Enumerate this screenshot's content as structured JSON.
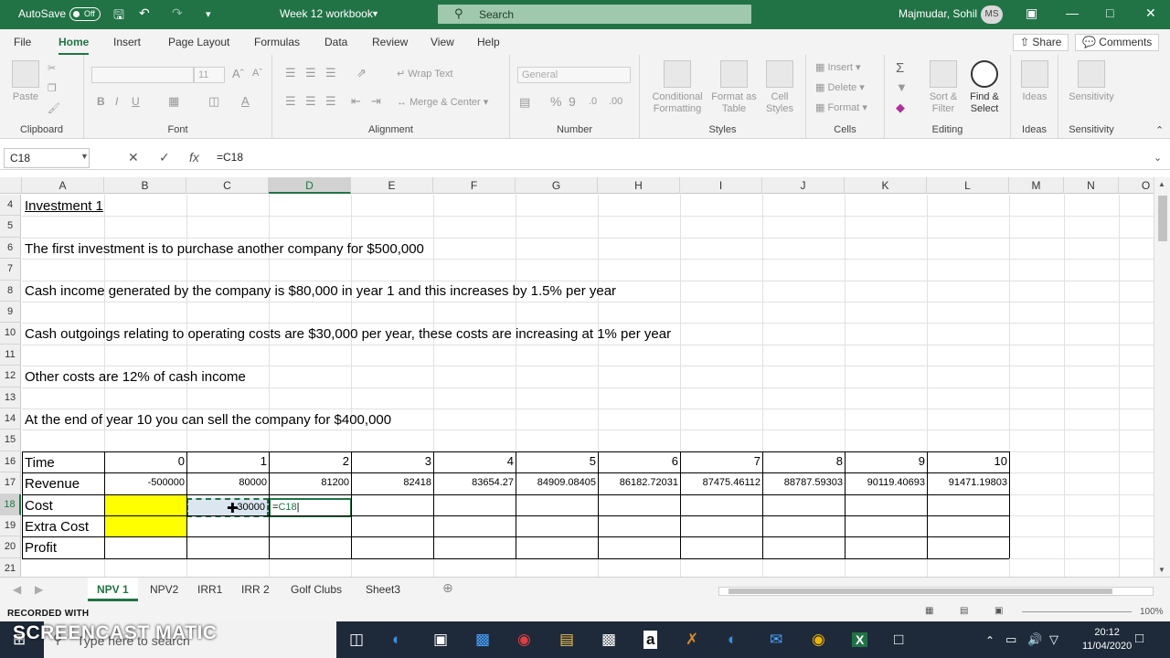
{
  "titlebar": {
    "autosave": "AutoSave",
    "toggle": "Off",
    "doc_title": "Week 12 workbook",
    "search": "Search",
    "user": "Majmudar, Sohil",
    "initials": "MS"
  },
  "ribbon_tabs": [
    "File",
    "Home",
    "Insert",
    "Page Layout",
    "Formulas",
    "Data",
    "Review",
    "View",
    "Help"
  ],
  "share": "Share",
  "comments": "Comments",
  "ribbon": {
    "clipboard": {
      "label": "Clipboard",
      "paste": "Paste"
    },
    "font": {
      "label": "Font",
      "size": "11"
    },
    "alignment": {
      "label": "Alignment",
      "wrap": "Wrap Text",
      "merge": "Merge & Center"
    },
    "number": {
      "label": "Number",
      "format": "General"
    },
    "styles": {
      "label": "Styles",
      "cond1": "Conditional",
      "cond2": "Formatting",
      "fmt1": "Format as",
      "fmt2": "Table",
      "cell1": "Cell",
      "cell2": "Styles"
    },
    "cells": {
      "label": "Cells",
      "insert": "Insert",
      "delete": "Delete",
      "format": "Format"
    },
    "editing": {
      "label": "Editing",
      "sort1": "Sort &",
      "sort2": "Filter",
      "find1": "Find &",
      "find2": "Select"
    },
    "ideas": {
      "label": "Ideas",
      "btn": "Ideas"
    },
    "sensitivity": {
      "label": "Sensitivity",
      "btn": "Sensitivity"
    }
  },
  "formula_bar": {
    "namebox": "C18",
    "formula": "=C18"
  },
  "columns": [
    "A",
    "B",
    "C",
    "D",
    "E",
    "F",
    "G",
    "H",
    "I",
    "J",
    "K",
    "L",
    "M",
    "N",
    "O"
  ],
  "rows": [
    "4",
    "5",
    "6",
    "7",
    "8",
    "9",
    "10",
    "11",
    "12",
    "13",
    "14",
    "15",
    "16",
    "17",
    "18",
    "19",
    "20",
    "21"
  ],
  "texts": {
    "investment": "Investment 1",
    "line6": "The first investment is to purchase another company for $500,000",
    "line8": "Cash income generated by the company is $80,000 in year 1 and this increases by 1.5% per year",
    "line10": "Cash outgoings relating to operating costs are $30,000 per year, these costs are increasing at 1% per year",
    "line12": "Other costs are 12% of cash income",
    "line14": "At the end of year 10 you can sell the company for $400,000"
  },
  "table": {
    "labels": [
      "Time",
      "Revenue",
      "Cost",
      "Extra Cost",
      "Profit"
    ],
    "time": [
      "0",
      "1",
      "2",
      "3",
      "4",
      "5",
      "6",
      "7",
      "8",
      "9",
      "10"
    ],
    "revenue": [
      "-500000",
      "80000",
      "81200",
      "82418",
      "83654.27",
      "84909.08405",
      "86182.72031",
      "87475.46112",
      "88787.59303",
      "90119.40693",
      "91471.19803"
    ],
    "c18": "30000",
    "d18_edit": "=C18"
  },
  "sheets": [
    "NPV 1",
    "NPV2",
    "IRR1",
    "IRR 2",
    "Golf Clubs",
    "Sheet3"
  ],
  "status": {
    "zoom": "100%"
  },
  "taskbar": {
    "search": "Type here to search",
    "time": "20:12",
    "date": "11/04/2020"
  },
  "watermark": {
    "line1": "RECORDED WITH",
    "line2": "SCREENCAST MATIC"
  },
  "colors": {
    "excel_green": "#217346",
    "highlight": "#ffff00",
    "taskbar": "#1e2a3a"
  }
}
